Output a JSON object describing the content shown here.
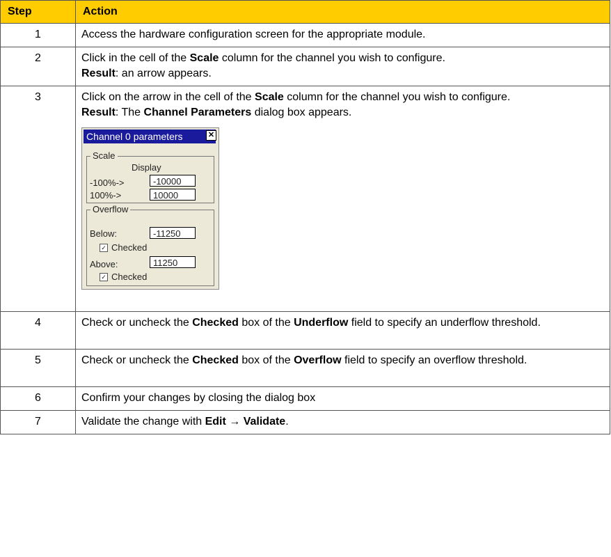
{
  "table": {
    "headers": {
      "step": "Step",
      "action": "Action"
    },
    "rows": [
      {
        "step": "1",
        "text": "Access the hardware configuration screen for the appropriate module."
      },
      {
        "step": "2",
        "a1": "Click in the cell of the ",
        "b1": "Scale",
        "a2": " column for the channel you wish to configure.",
        "r_label": "Result",
        "r_text": ": an arrow appears."
      },
      {
        "step": "3",
        "a1": "Click on the arrow in the cell of the ",
        "b1": "Scale",
        "a2": " column for the channel you wish to configure.",
        "r_label": "Result",
        "r_text1": ": The ",
        "r_bold": "Channel Parameters",
        "r_text2": " dialog box appears."
      },
      {
        "step": "4",
        "a1": "Check or uncheck the ",
        "b1": "Checked",
        "a2": " box of the ",
        "b2": "Underflow",
        "a3": " field to specify an underflow threshold."
      },
      {
        "step": "5",
        "a1": "Check or uncheck the ",
        "b1": "Checked",
        "a2": " box of the ",
        "b2": "Overflow",
        "a3": " field to specify an overflow threshold."
      },
      {
        "step": "6",
        "text": "Confirm your changes by closing the dialog box"
      },
      {
        "step": "7",
        "a1": "Validate the change with ",
        "b1": "Edit",
        "arrow": " → ",
        "b2": "Validate",
        "a2": "."
      }
    ]
  },
  "dialog": {
    "title": "Channel 0 parameters",
    "close_glyph": "✕",
    "scale_label": "Scale",
    "display_label": "Display",
    "neg_label": "-100%->",
    "neg_value": "-10000",
    "pos_label": "100%->",
    "pos_value": "10000",
    "overflow_label": "Overflow",
    "below_label": "Below:",
    "below_value": "-11250",
    "below_checked": "Checked",
    "above_label": "Above:",
    "above_value": "11250",
    "above_checked": "Checked",
    "check_glyph": "✓"
  }
}
